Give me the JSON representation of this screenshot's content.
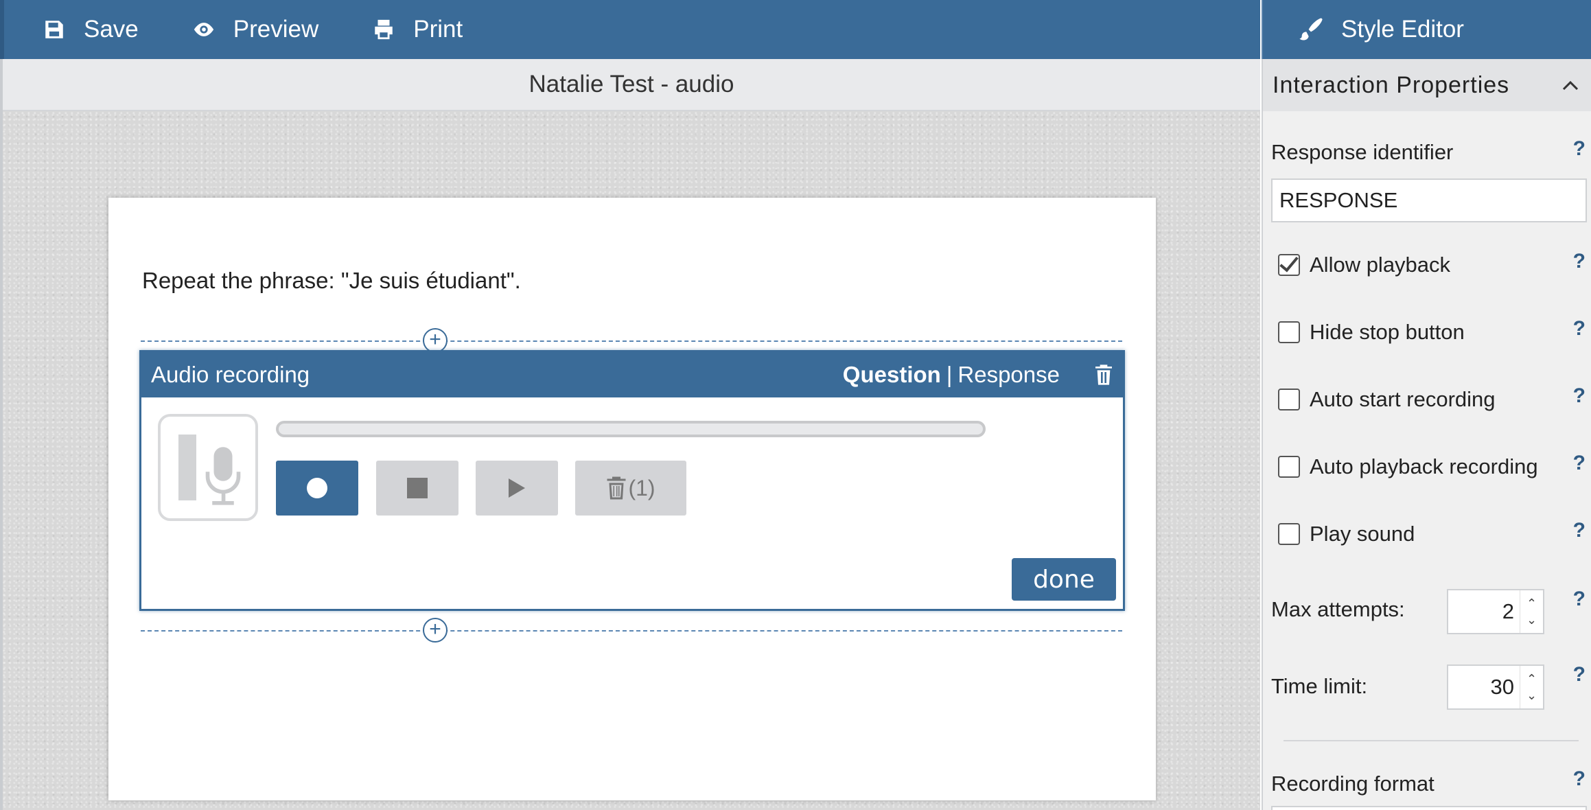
{
  "toolbar": {
    "save_label": "Save",
    "preview_label": "Preview",
    "print_label": "Print",
    "style_editor_label": "Style Editor"
  },
  "document": {
    "title": "Natalie Test - audio",
    "prompt": "Repeat the phrase: \"Je suis étudiant\"."
  },
  "interaction": {
    "title": "Audio recording",
    "tab_question": "Question",
    "tab_separator": "|",
    "tab_response": "Response",
    "delete_count": "(1)",
    "done_label": "done",
    "record_color": "#3a6b98"
  },
  "panel": {
    "heading": "Interaction Properties",
    "response_identifier_label": "Response identifier",
    "response_identifier_value": "RESPONSE",
    "help_mark": "?",
    "checkboxes": [
      {
        "label": "Allow playback",
        "checked": true
      },
      {
        "label": "Hide stop button",
        "checked": false
      },
      {
        "label": "Auto start recording",
        "checked": false
      },
      {
        "label": "Auto playback recording",
        "checked": false
      },
      {
        "label": "Play sound",
        "checked": false
      }
    ],
    "max_attempts_label": "Max attempts:",
    "max_attempts_value": "2",
    "time_limit_label": "Time limit:",
    "time_limit_value": "30",
    "recording_format_label": "Recording format"
  },
  "colors": {
    "brand": "#3a6b98",
    "help": "#2f5a83"
  }
}
